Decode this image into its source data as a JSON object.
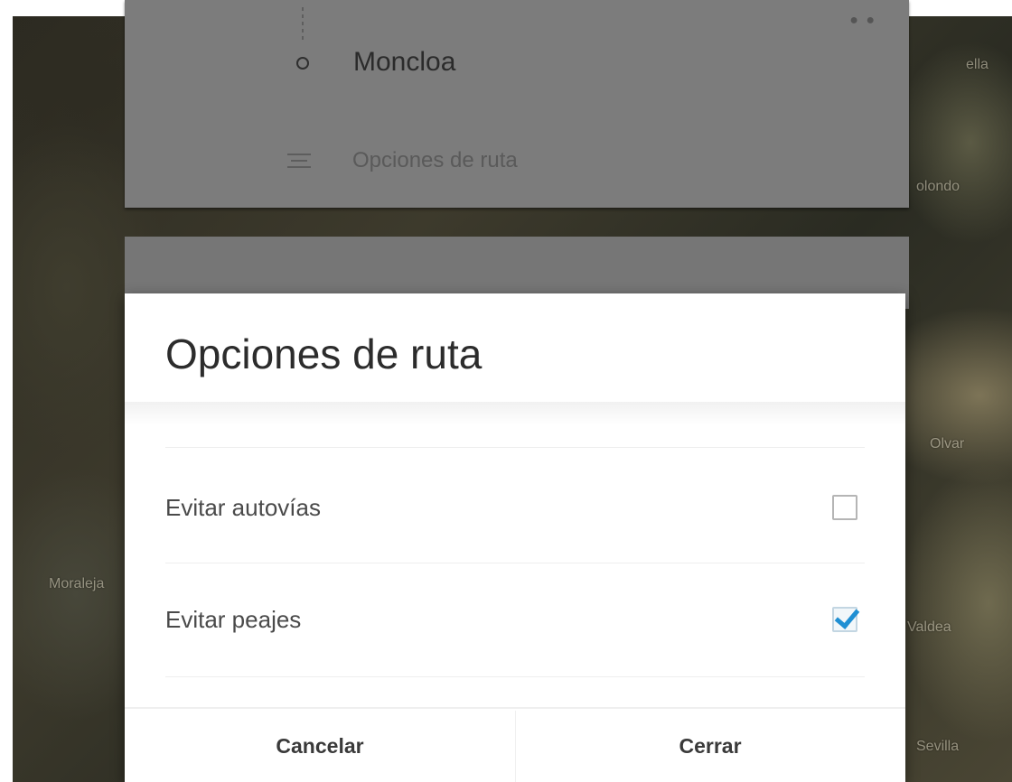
{
  "map": {
    "labels": [
      "ella",
      "olondo",
      "Olvar",
      "Valdea",
      "Moraleja",
      "Sevilla"
    ]
  },
  "directions": {
    "destination": "Moncloa",
    "route_options_label": "Opciones de ruta"
  },
  "dialog": {
    "title": "Opciones de ruta",
    "options": [
      {
        "label": "Evitar autovías",
        "checked": false
      },
      {
        "label": "Evitar peajes",
        "checked": true
      }
    ],
    "cancel_label": "Cancelar",
    "close_label": "Cerrar"
  },
  "colors": {
    "accent": "#1f8fd3",
    "scrim_card": "#7c7c7c",
    "dialog_bg": "#ffffff"
  }
}
